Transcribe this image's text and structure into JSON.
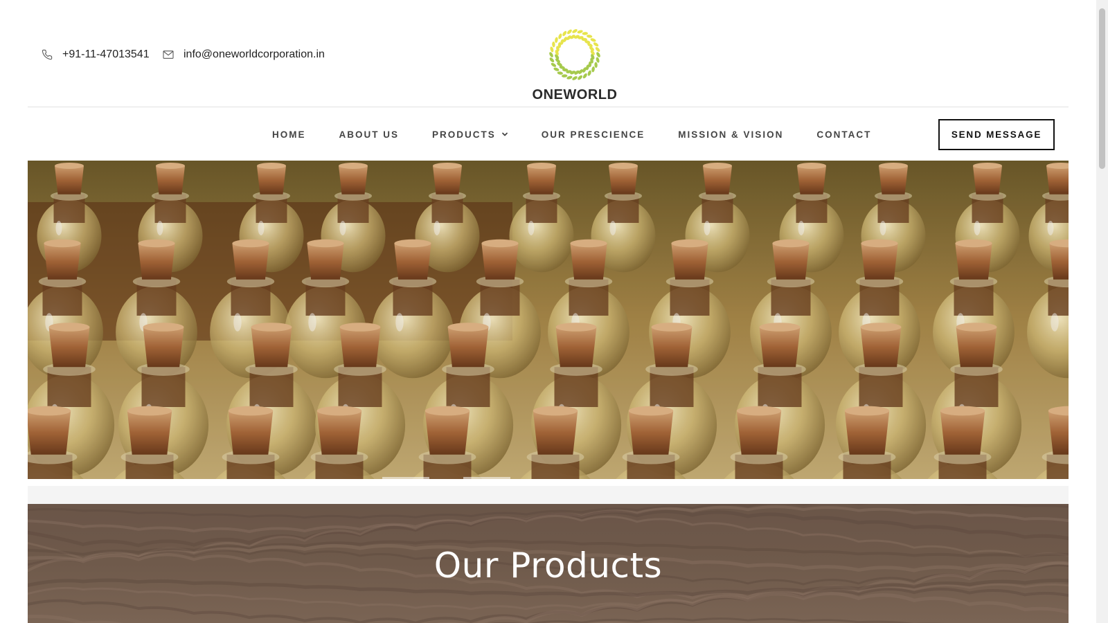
{
  "header": {
    "phone": "+91-11-47013541",
    "email": "info@oneworldcorporation.in",
    "logo_text": "ONEWORLD"
  },
  "nav": {
    "items": [
      {
        "label": "HOME"
      },
      {
        "label": "ABOUT US"
      },
      {
        "label": "PRODUCTS"
      },
      {
        "label": "OUR PRESCIENCE"
      },
      {
        "label": "MISSION & VISION"
      },
      {
        "label": "CONTACT"
      }
    ],
    "send_button": "SEND MESSAGE"
  },
  "hero": {
    "image_description_icon": "cork-bottles-image"
  },
  "products_section": {
    "title": "Our Products"
  },
  "colors": {
    "logo_green": "#9cc43a",
    "logo_yellow": "#e4e13a",
    "text_dark": "#222222",
    "banner_brown": "#6f5a4b"
  }
}
